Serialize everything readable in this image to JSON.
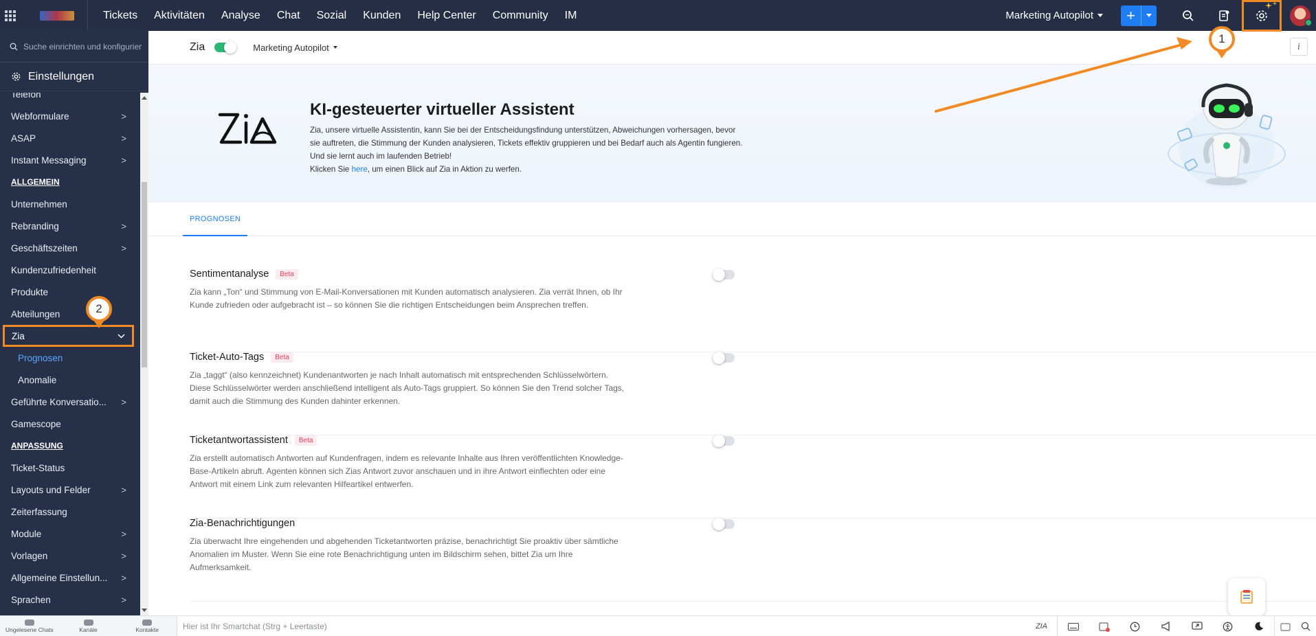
{
  "topnav": {
    "items": [
      "Tickets",
      "Aktivitäten",
      "Analyse",
      "Chat",
      "Sozial",
      "Kunden",
      "Help Center",
      "Community",
      "IM"
    ],
    "department": "Marketing Autopilot",
    "add_label": "+"
  },
  "sidebar": {
    "search_placeholder": "Suche einrichten und konfigurier",
    "heading": "Einstellungen",
    "items_top": [
      {
        "label": "Telefon",
        "chevron": false
      },
      {
        "label": "Webformulare",
        "chevron": true
      },
      {
        "label": "ASAP",
        "chevron": true
      },
      {
        "label": "Instant Messaging",
        "chevron": true
      }
    ],
    "section_allgemein": "ALLGEMEIN",
    "items_allgemein": [
      {
        "label": "Unternehmen",
        "chevron": false
      },
      {
        "label": "Rebranding",
        "chevron": true
      },
      {
        "label": "Geschäftszeiten",
        "chevron": true
      },
      {
        "label": "Kundenzufriedenheit",
        "chevron": false
      },
      {
        "label": "Produkte",
        "chevron": false
      },
      {
        "label": "Abteilungen",
        "chevron": false
      }
    ],
    "zia_label": "Zia",
    "zia_sub": [
      "Prognosen",
      "Anomalie"
    ],
    "items_after_zia": [
      {
        "label": "Geführte Konversatio...",
        "chevron": true
      },
      {
        "label": "Gamescope",
        "chevron": false
      }
    ],
    "section_anpassung": "ANPASSUNG",
    "items_anpassung": [
      {
        "label": "Ticket-Status",
        "chevron": false
      },
      {
        "label": "Layouts und Felder",
        "chevron": true
      },
      {
        "label": "Zeiterfassung",
        "chevron": false
      },
      {
        "label": "Module",
        "chevron": true
      },
      {
        "label": "Vorlagen",
        "chevron": true
      },
      {
        "label": "Allgemeine Einstellun...",
        "chevron": true
      },
      {
        "label": "Sprachen",
        "chevron": true
      }
    ]
  },
  "header": {
    "title": "Zia",
    "toggle_on": true,
    "department": "Marketing Autopilot",
    "info": "i"
  },
  "hero": {
    "title": "KI-gesteuerter virtueller Assistent",
    "text": "Zia, unsere virtuelle Assistentin, kann Sie bei der Entscheidungsfindung unterstützen, Abweichungen vorhersagen, bevor sie auftreten, die Stimmung der Kunden analysieren, Tickets effektiv gruppieren und bei Bedarf auch als Agentin fungieren. Und sie lernt auch im laufenden Betrieb!",
    "link_prefix": "Klicken Sie ",
    "link_text": "here",
    "link_suffix": ", um einen Blick auf Zia in Aktion zu werfen."
  },
  "tabs": [
    "PROGNOSEN"
  ],
  "features": [
    {
      "title": "Sentimentanalyse",
      "beta": "Beta",
      "enabled": false,
      "description": "Zia kann „Ton“ und Stimmung von E-Mail-Konversationen mit Kunden automatisch analysieren. Zia verrät Ihnen, ob Ihr Kunde zufrieden oder aufgebracht ist – so können Sie die richtigen Entscheidungen beim Ansprechen treffen."
    },
    {
      "title": "Ticket-Auto-Tags",
      "beta": "Beta",
      "enabled": false,
      "description": "Zia „taggt“ (also kennzeichnet) Kundenantworten je nach Inhalt automatisch mit entsprechenden Schlüsselwörtern. Diese Schlüsselwörter werden anschließend intelligent als Auto-Tags gruppiert. So können Sie den Trend solcher Tags, damit auch die Stimmung des Kunden dahinter erkennen."
    },
    {
      "title": "Ticketantwortassistent",
      "beta": "Beta",
      "enabled": false,
      "description": "Zia erstellt automatisch Antworten auf Kundenfragen, indem es relevante Inhalte aus Ihren veröffentlichten Knowledge-Base-Artikeln abruft. Agenten können sich Zias Antwort zuvor anschauen und in ihre Antwort einflechten oder eine Antwort mit einem Link zum relevanten Hilfeartikel entwerfen."
    },
    {
      "title": "Zia-Benachrichtigungen",
      "beta": "",
      "enabled": false,
      "description": "Zia überwacht Ihre eingehenden und abgehenden Ticketantworten präzise, benachrichtigt Sie proaktiv über sämtliche Anomalien im Muster. Wenn Sie eine rote Benachrichtigung unten im Bildschirm sehen, bittet Zia um Ihre Aufmerksamkeit."
    }
  ],
  "bottombar": {
    "items": [
      "Ungelesene Chats",
      "Kanäle",
      "Kontakte"
    ],
    "smartchat_placeholder": "Hier ist Ihr Smartchat (Strg + Leertaste)",
    "zia_short": "ZIA"
  },
  "annotations": [
    "1",
    "2"
  ],
  "colors": {
    "accent": "#1e7df3",
    "highlight": "#f08a24",
    "nav": "#252e45",
    "sidebar": "#263048"
  }
}
